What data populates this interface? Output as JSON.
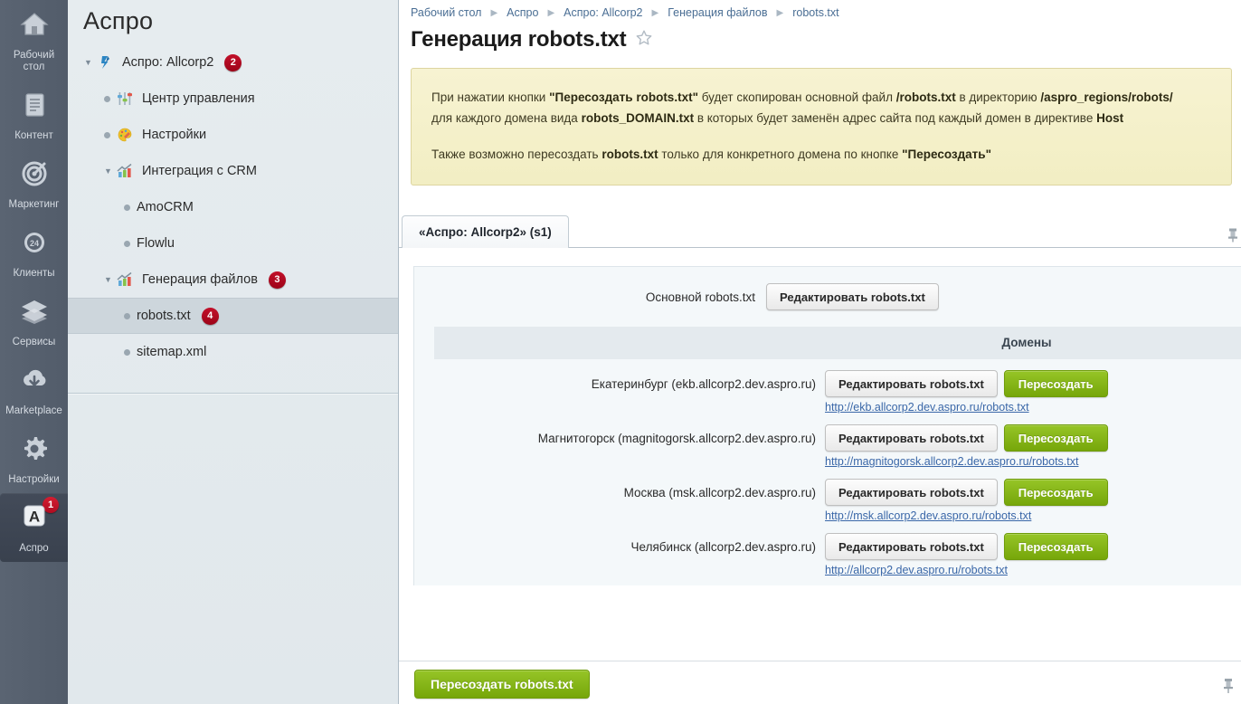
{
  "rail": {
    "items": [
      {
        "label": "Рабочий\nстол",
        "icon": "home-icon",
        "badge": null,
        "active": false
      },
      {
        "label": "Контент",
        "icon": "document-icon",
        "badge": null,
        "active": false
      },
      {
        "label": "Маркетинг",
        "icon": "target-icon",
        "badge": null,
        "active": false
      },
      {
        "label": "Клиенты",
        "icon": "crm24-icon",
        "badge": null,
        "active": false
      },
      {
        "label": "Сервисы",
        "icon": "layers-icon",
        "badge": null,
        "active": false
      },
      {
        "label": "Marketplace",
        "icon": "cloud-download-icon",
        "badge": null,
        "active": false
      },
      {
        "label": "Настройки",
        "icon": "gear-icon",
        "badge": null,
        "active": false
      },
      {
        "label": "Аспро",
        "icon": "aspro-letter-icon",
        "badge": "1",
        "active": true
      }
    ]
  },
  "tree": {
    "title": "Аспро",
    "items": [
      {
        "label": "Аспро: Allcorp2",
        "level": 1,
        "twisty": "▼",
        "icon": "aspro-logo-icon",
        "badge": "2",
        "selected": false
      },
      {
        "label": "Центр управления",
        "level": 2,
        "twisty": "",
        "icon": "sliders-icon",
        "badge": null,
        "selected": false
      },
      {
        "label": "Настройки",
        "level": 2,
        "twisty": "",
        "icon": "palette-icon",
        "badge": null,
        "selected": false
      },
      {
        "label": "Интеграция с CRM",
        "level": 2,
        "twisty": "▼",
        "icon": "chart-icon",
        "badge": null,
        "selected": false
      },
      {
        "label": "AmoCRM",
        "level": 3,
        "twisty": "",
        "icon": "none",
        "badge": null,
        "selected": false
      },
      {
        "label": "Flowlu",
        "level": 3,
        "twisty": "",
        "icon": "none",
        "badge": null,
        "selected": false
      },
      {
        "label": "Генерация файлов",
        "level": 2,
        "twisty": "▼",
        "icon": "chart-icon",
        "badge": "3",
        "selected": false
      },
      {
        "label": "robots.txt",
        "level": 3,
        "twisty": "",
        "icon": "none",
        "badge": "4",
        "selected": true
      },
      {
        "label": "sitemap.xml",
        "level": 3,
        "twisty": "",
        "icon": "none",
        "badge": null,
        "selected": false
      }
    ]
  },
  "breadcrumb": {
    "items": [
      "Рабочий стол",
      "Аспро",
      "Аспро: Allcorp2",
      "Генерация файлов",
      "robots.txt"
    ],
    "separator": "▶"
  },
  "page": {
    "title": "Генерация robots.txt",
    "favorite_icon": "star-icon"
  },
  "notice": {
    "line1_a": "При нажатии кнопки ",
    "line1_b": "\"Пересоздать robots.txt\"",
    "line1_c": " будет скопирован основной файл ",
    "line1_d": "/robots.txt",
    "line1_e": " в директорию ",
    "line1_f": "/aspro_regions/robots/",
    "line2_a": "для каждого домена вида ",
    "line2_b": "robots_DOMAIN.txt",
    "line2_c": " в которых будет заменён адрес сайта под каждый домен в директиве ",
    "line2_d": "Host",
    "line3_a": "Также возможно пересоздать ",
    "line3_b": "robots.txt",
    "line3_c": " только для конкретного домена по кнопке ",
    "line3_d": "\"Пересоздать\""
  },
  "tabs": [
    {
      "label": "«Аспро: Allcorp2» (s1)",
      "active": true
    }
  ],
  "main_row": {
    "label": "Основной robots.txt",
    "edit_button": "Редактировать robots.txt"
  },
  "domains": {
    "header": "Домены",
    "edit_button": "Редактировать robots.txt",
    "regen_button": "Пересоздать",
    "rows": [
      {
        "label": "Екатеринбург (ekb.allcorp2.dev.aspro.ru)",
        "link": "http://ekb.allcorp2.dev.aspro.ru/robots.txt"
      },
      {
        "label": "Магнитогорск (magnitogorsk.allcorp2.dev.aspro.ru)",
        "link": "http://magnitogorsk.allcorp2.dev.aspro.ru/robots.txt"
      },
      {
        "label": "Москва (msk.allcorp2.dev.aspro.ru)",
        "link": "http://msk.allcorp2.dev.aspro.ru/robots.txt"
      },
      {
        "label": "Челябинск (allcorp2.dev.aspro.ru)",
        "link": "http://allcorp2.dev.aspro.ru/robots.txt"
      }
    ]
  },
  "footer": {
    "regen_all_button": "Пересоздать robots.txt"
  },
  "colors": {
    "accent_green": "#85b517",
    "badge_red": "#b4071d",
    "rail_bg": "#555f6e",
    "tree_bg": "#e3eaee",
    "notice_bg": "#f6f2cd",
    "link_blue": "#3a67a8"
  }
}
